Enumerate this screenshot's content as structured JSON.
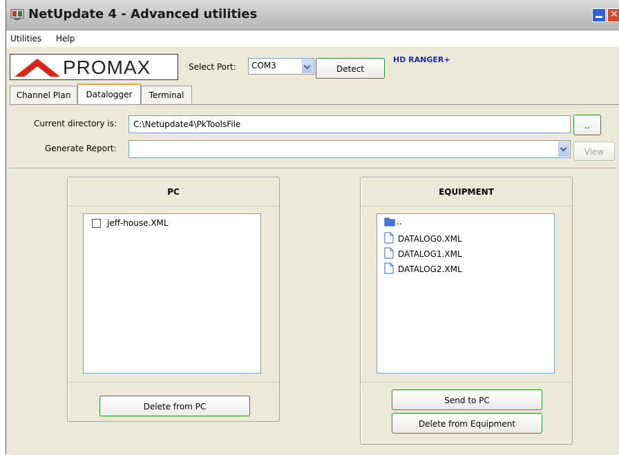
{
  "window": {
    "title": "NetUpdate 4 - Advanced utilities"
  },
  "menu": [
    "Utilities",
    "Help"
  ],
  "brand": {
    "logo_text": "PROMAX",
    "device": "HD RANGER+"
  },
  "port": {
    "label": "Select Port:",
    "value": "COM3",
    "detect_label": "Detect"
  },
  "tabs": [
    {
      "label": "Channel Plan",
      "active": false
    },
    {
      "label": "Datalogger",
      "active": true
    },
    {
      "label": "Terminal",
      "active": false
    }
  ],
  "directory": {
    "label": "Current directory is:",
    "value": "C:\\Netupdate4\\PkToolsFile",
    "browse_label": ".."
  },
  "report": {
    "label": "Generate Report:",
    "value": "",
    "view_label": "View"
  },
  "pc": {
    "title": "PC",
    "files": [
      {
        "name": "jeff-house.XML",
        "checked": false
      }
    ],
    "delete_label": "Delete from PC"
  },
  "equipment": {
    "title": "EQUIPMENT",
    "parent_dir": "..",
    "files": [
      "DATALOG0.XML",
      "DATALOG1.XML",
      "DATALOG2.XML"
    ],
    "send_label": "Send to PC",
    "delete_label": "Delete from Equipment"
  },
  "colors": {
    "accent": "#f8a829",
    "button_border": "#2f8a2f",
    "device_text": "#1d2e9b",
    "logo_red": "#d8261a"
  }
}
